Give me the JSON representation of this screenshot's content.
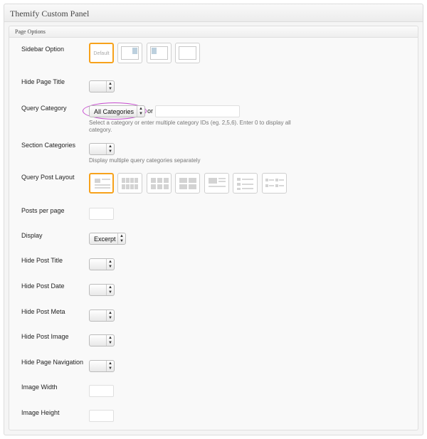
{
  "panel": {
    "title": "Themify Custom Panel",
    "section_title": "Page Options"
  },
  "fields": {
    "sidebar_option": {
      "label": "Sidebar Option",
      "default_text": "Default"
    },
    "hide_page_title": {
      "label": "Hide Page Title",
      "value": ""
    },
    "query_category": {
      "label": "Query Category",
      "value": "All Categories",
      "or_text": "or",
      "ids_value": "",
      "help_line1": "Select a category or enter multiple category IDs (eg. 2,5,6). Enter 0 to display all",
      "help_line2": "category."
    },
    "section_categories": {
      "label": "Section Categories",
      "value": "",
      "help": "Display multiple query categories separately"
    },
    "query_post_layout": {
      "label": "Query Post Layout"
    },
    "posts_per_page": {
      "label": "Posts per page",
      "value": ""
    },
    "display": {
      "label": "Display",
      "value": "Excerpt"
    },
    "hide_post_title": {
      "label": "Hide Post Title",
      "value": ""
    },
    "hide_post_date": {
      "label": "Hide Post Date",
      "value": ""
    },
    "hide_post_meta": {
      "label": "Hide Post Meta",
      "value": ""
    },
    "hide_post_image": {
      "label": "Hide Post Image",
      "value": ""
    },
    "hide_page_navigation": {
      "label": "Hide Page Navigation",
      "value": ""
    },
    "image_width": {
      "label": "Image Width",
      "value": ""
    },
    "image_height": {
      "label": "Image Height",
      "value": ""
    }
  },
  "colors": {
    "selected_border": "#f7a21b",
    "highlight_oval": "#c64ccf",
    "sidebar_bar": "#bcd0de"
  },
  "icons": {
    "select_arrow": "up-down-arrows-icon"
  }
}
